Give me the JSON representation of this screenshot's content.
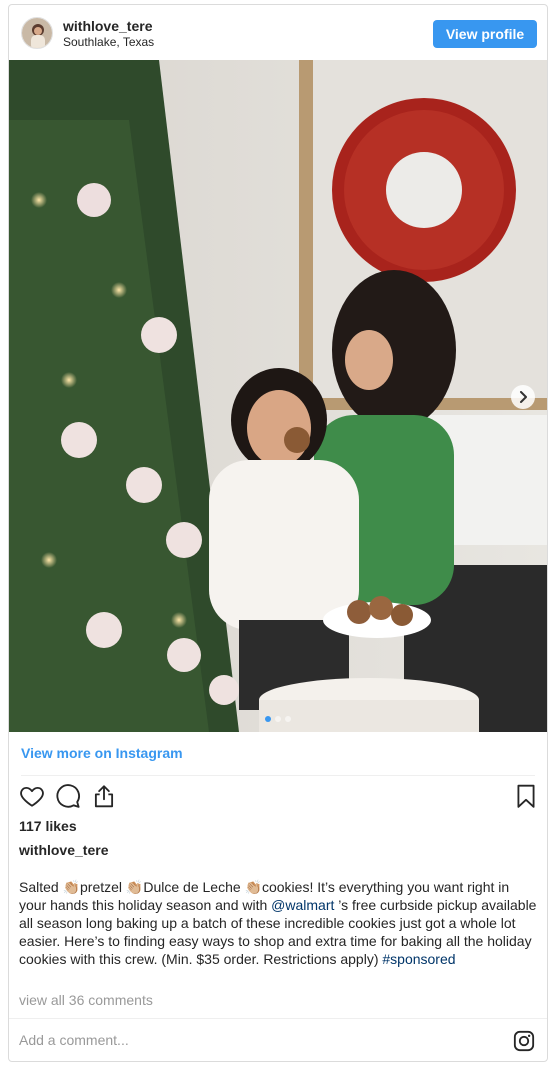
{
  "header": {
    "username": "withlove_tere",
    "location": "Southlake, Texas",
    "view_profile_label": "View profile"
  },
  "carousel": {
    "total_slides": 3,
    "active_slide": 1
  },
  "view_more_label": "View more on Instagram",
  "likes": "117 likes",
  "owner_username": "withlove_tere",
  "caption": {
    "part1": "Salted 👏🏼pretzel 👏🏼Dulce de Leche 👏🏼cookies! It’s everything you want right in your hands this holiday season and with ",
    "mention": "@walmart",
    "part2": " ’s free curbside pickup available all season long baking up a batch of these incredible cookies just got a whole lot easier. Here’s to finding easy ways to shop and extra time for baking all the holiday cookies with this crew. (Min. $35 order. Restrictions apply) ",
    "hashtag": "#sponsored"
  },
  "comments_link": "view all 36 comments",
  "comment_input": {
    "placeholder": "Add a comment..."
  },
  "colors": {
    "accent": "#3897f0",
    "link_dark": "#003569",
    "muted": "#999999"
  },
  "icons": [
    "heart-icon",
    "comment-icon",
    "share-icon",
    "bookmark-icon",
    "instagram-icon",
    "chevron-right-icon"
  ]
}
